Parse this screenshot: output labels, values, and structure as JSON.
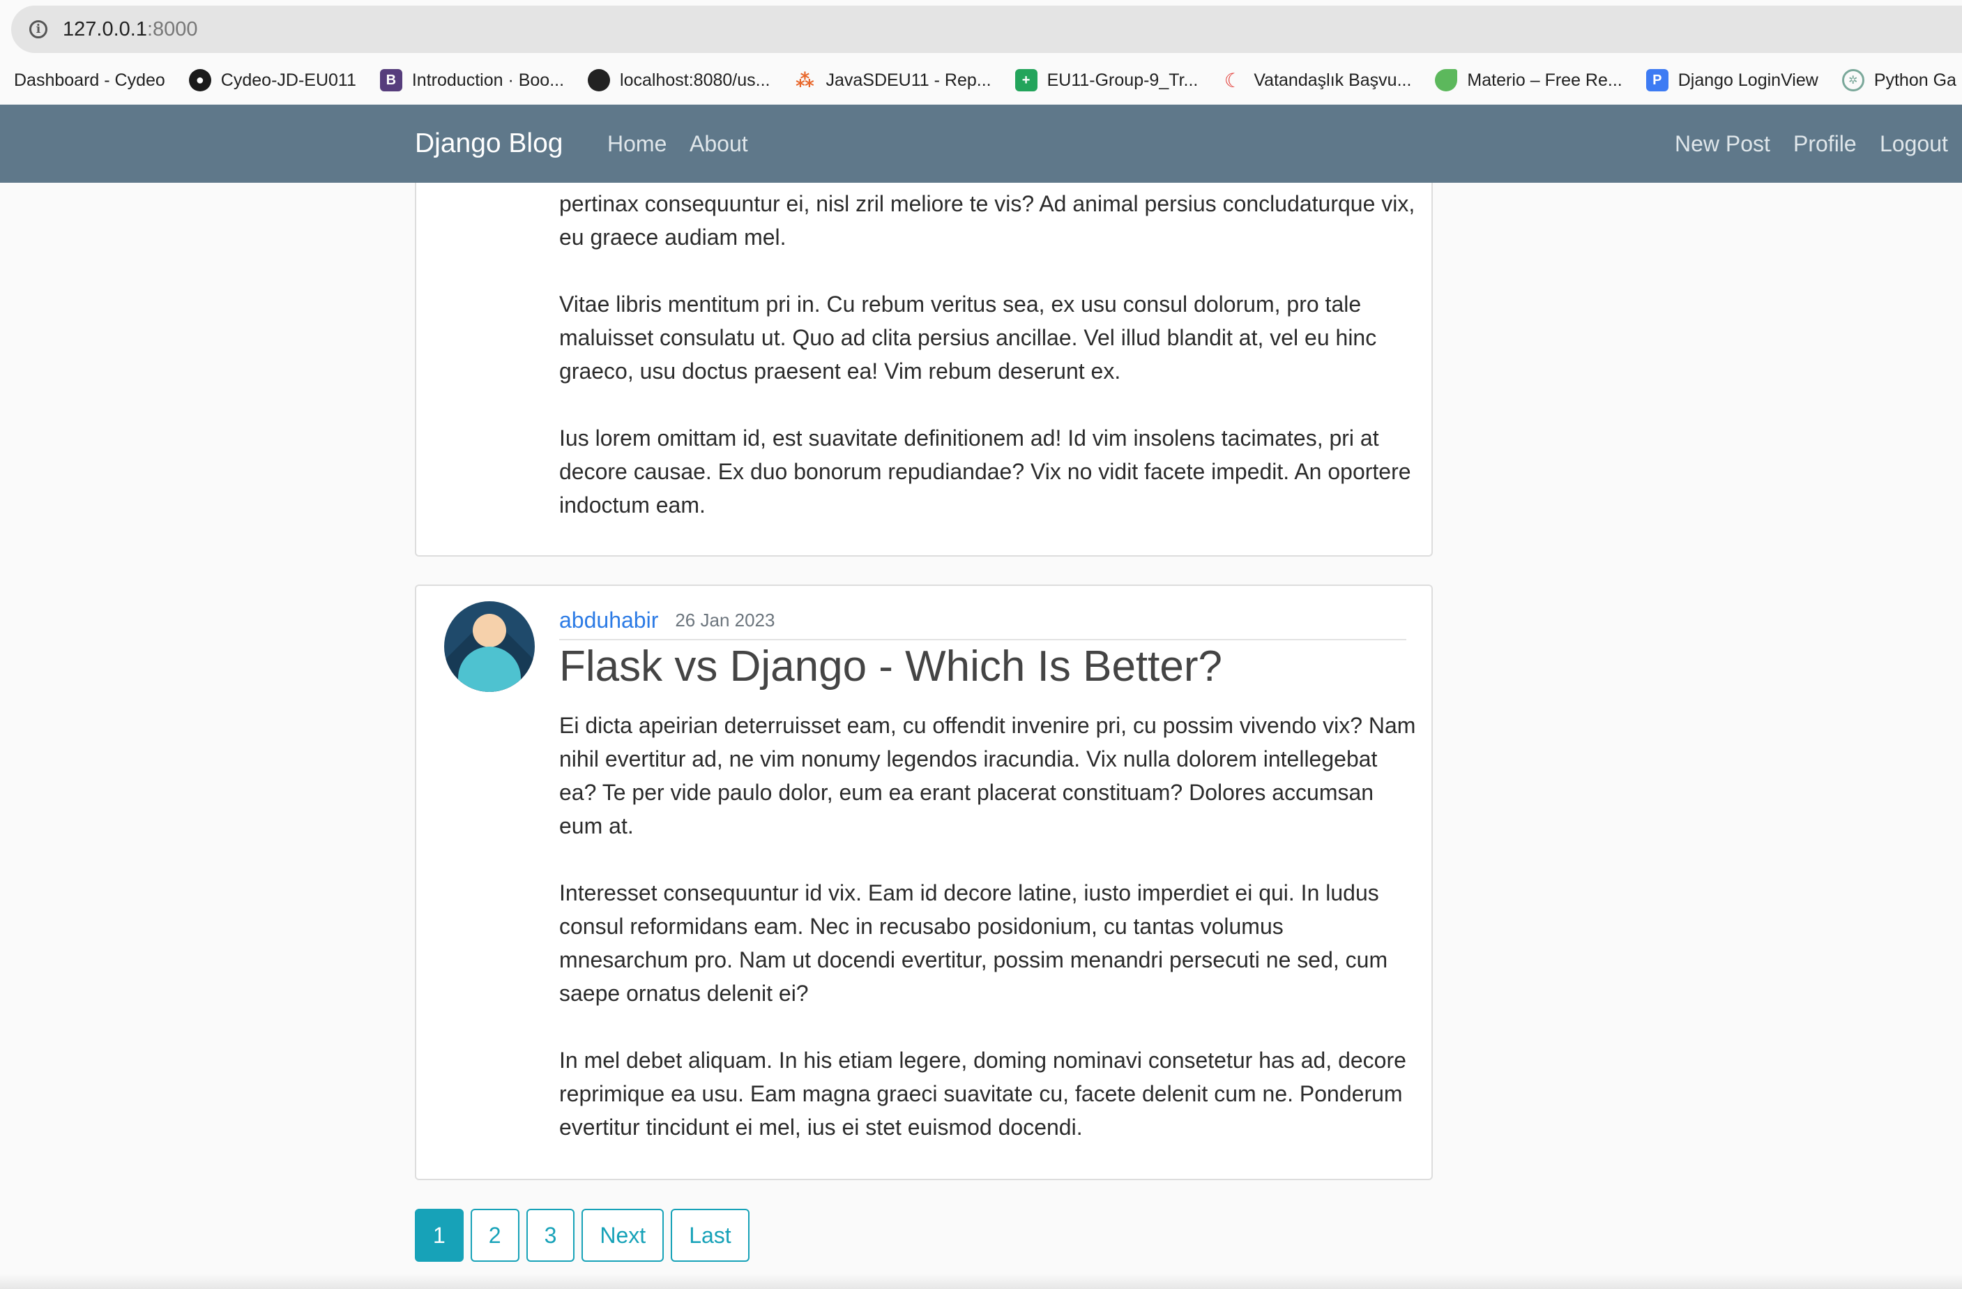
{
  "browser": {
    "url_host": "127.0.0.1",
    "url_port": ":8000",
    "bookmarks": [
      {
        "label": "Dashboard - Cydeo",
        "icon": "cydeo-icon"
      },
      {
        "label": "Cydeo-JD-EU011",
        "icon": "github-icon"
      },
      {
        "label": "Introduction · Boo...",
        "icon": "bootstrap-icon"
      },
      {
        "label": "localhost:8080/us...",
        "icon": "globe-icon"
      },
      {
        "label": "JavaSDEU11 - Rep...",
        "icon": "git-icon"
      },
      {
        "label": "EU11-Group-9_Tr...",
        "icon": "sheets-icon"
      },
      {
        "label": "Vatandaşlık Başvu...",
        "icon": "crescent-icon"
      },
      {
        "label": "Materio – Free Re...",
        "icon": "materio-icon"
      },
      {
        "label": "Django LoginView",
        "icon": "p-icon"
      },
      {
        "label": "Python Ga",
        "icon": "openai-icon"
      }
    ]
  },
  "navbar": {
    "brand": "Django Blog",
    "home": "Home",
    "about": "About",
    "new_post": "New Post",
    "profile": "Profile",
    "logout": "Logout",
    "color": "#5f788a"
  },
  "posts": [
    {
      "paragraphs": [
        "pertinax consequuntur ei, nisl zril meliore te vis? Ad animal persius concludaturque vix, eu graece audiam mel.",
        "Vitae libris mentitum pri in. Cu rebum veritus sea, ex usu consul dolorum, pro tale maluisset consulatu ut. Quo ad clita persius ancillae. Vel illud blandit at, vel eu hinc graeco, usu doctus praesent ea! Vim rebum deserunt ex.",
        "Ius lorem omittam id, est suavitate definitionem ad! Id vim insolens tacimates, pri at decore causae. Ex duo bonorum repudiandae? Vix no vidit facete impedit. An oportere indoctum eam."
      ]
    },
    {
      "author": "abduhabir",
      "date": "26 Jan 2023",
      "title": "Flask vs Django - Which Is Better?",
      "paragraphs": [
        "Ei dicta apeirian deterruisset eam, cu offendit invenire pri, cu possim vivendo vix? Nam nihil evertitur ad, ne vim nonumy legendos iracundia. Vix nulla dolorem intellegebat ea? Te per vide paulo dolor, eum ea erant placerat constituam? Dolores accumsan eum at.",
        "Interesset consequuntur id vix. Eam id decore latine, iusto imperdiet ei qui. In ludus consul reformidans eam. Nec in recusabo posidonium, cu tantas volumus mnesarchum pro. Nam ut docendi evertitur, possim menandri persecuti ne sed, cum saepe ornatus delenit ei?",
        "In mel debet aliquam. In his etiam legere, doming nominavi consetetur has ad, decore reprimique ea usu. Eam magna graeci suavitate cu, facete delenit cum ne. Ponderum evertitur tincidunt ei mel, ius ei stet euismod docendi."
      ]
    }
  ],
  "pagination": {
    "pages": [
      "1",
      "2",
      "3"
    ],
    "active": "1",
    "next": "Next",
    "last": "Last",
    "accent": "#17a2b8"
  }
}
